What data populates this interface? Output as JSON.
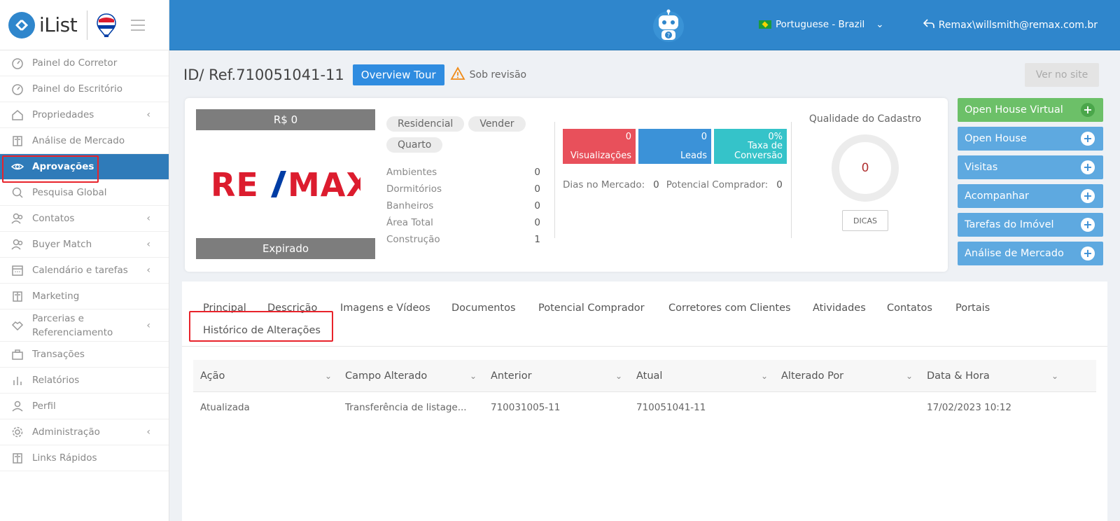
{
  "brand": {
    "name": "iList"
  },
  "sidebar": {
    "items": [
      {
        "label": "Painel do Corretor",
        "icon": "gauge-icon",
        "chevron": false
      },
      {
        "label": "Painel do Escritório",
        "icon": "gauge-icon",
        "chevron": false
      },
      {
        "label": "Propriedades",
        "icon": "home-icon",
        "chevron": true
      },
      {
        "label": "Análise de Mercado",
        "icon": "book-icon",
        "chevron": false
      },
      {
        "label": "Aprovações",
        "icon": "eye-icon",
        "chevron": false,
        "active": true
      },
      {
        "label": "Pesquisa Global",
        "icon": "search-icon",
        "chevron": false
      },
      {
        "label": "Contatos",
        "icon": "users-icon",
        "chevron": true
      },
      {
        "label": "Buyer Match",
        "icon": "users-icon",
        "chevron": true
      },
      {
        "label": "Calendário e tarefas",
        "icon": "calendar-icon",
        "chevron": true
      },
      {
        "label": "Marketing",
        "icon": "book-icon",
        "chevron": false
      },
      {
        "label": "Parcerias e Referenciamento",
        "icon": "handshake-icon",
        "chevron": true
      },
      {
        "label": "Transações",
        "icon": "briefcase-icon",
        "chevron": false
      },
      {
        "label": "Relatórios",
        "icon": "bars-icon",
        "chevron": false
      },
      {
        "label": "Perfil",
        "icon": "user-icon",
        "chevron": false
      },
      {
        "label": "Administração",
        "icon": "gear-icon",
        "chevron": true
      },
      {
        "label": "Links Rápidos",
        "icon": "book-icon",
        "chevron": false
      }
    ]
  },
  "header": {
    "language": "Portuguese - Brazil",
    "user": "Remax\\willsmith@remax.com.br"
  },
  "page": {
    "ref": "ID/ Ref.710051041-11",
    "tour_button": "Overview Tour",
    "status": "Sob revisão",
    "site_button": "Ver no site"
  },
  "listing": {
    "price": "R$ 0",
    "logo_text": "RE/MAX",
    "expired": "Expirado",
    "chips": [
      "Residencial",
      "Vender",
      "Quarto"
    ],
    "specs": [
      {
        "label": "Ambientes",
        "value": "0"
      },
      {
        "label": "Dormitórios",
        "value": "0"
      },
      {
        "label": "Banheiros",
        "value": "0"
      },
      {
        "label": "Área Total",
        "value": "0"
      },
      {
        "label": "Construção",
        "value": "1"
      }
    ],
    "stats": [
      {
        "value": "0",
        "label": "Visualizações",
        "color": "#e8505b"
      },
      {
        "value": "0",
        "label": "Leads",
        "color": "#3b92d8"
      },
      {
        "value": "0%",
        "label": "Taxa de Conversão",
        "color": "#35c3c9"
      }
    ],
    "days_label": "Dias no Mercado:",
    "days_value": "0",
    "buyer_label": "Potencial Comprador:",
    "buyer_value": "0",
    "quality_title": "Qualidade do Cadastro",
    "quality_value": "0",
    "tips_button": "DICAS"
  },
  "actions": [
    {
      "label": "Open House Virtual",
      "green": true
    },
    {
      "label": "Open House",
      "green": false
    },
    {
      "label": "Visitas",
      "green": false
    },
    {
      "label": "Acompanhar",
      "green": false
    },
    {
      "label": "Tarefas do Imóvel",
      "green": false
    },
    {
      "label": "Análise de Mercado",
      "green": false
    }
  ],
  "tabs": [
    "Principal",
    "Descrição",
    "Imagens e Vídeos",
    "Documentos",
    "Potencial Comprador",
    "Corretores com Clientes",
    "Atividades",
    "Contatos",
    "Portais",
    "Histórico de Alterações"
  ],
  "table": {
    "columns": [
      "Ação",
      "Campo Alterado",
      "Anterior",
      "Atual",
      "Alterado Por",
      "Data & Hora"
    ],
    "rows": [
      [
        "Atualizada",
        "Transferência de listage...",
        "710031005-11",
        "710051041-11",
        "",
        "17/02/2023 10:12"
      ]
    ]
  },
  "colors": {
    "accent": "#2f86cc",
    "highlight": "#e8232b",
    "remax_red": "#dc1c2e",
    "remax_blue": "#003da5"
  }
}
